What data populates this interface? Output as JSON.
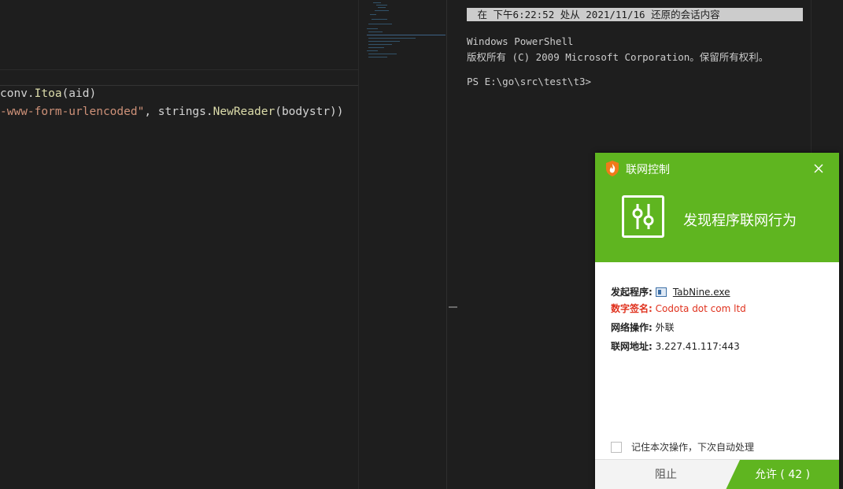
{
  "editor": {
    "lines": [
      {
        "parts": [
          {
            "t": "conv.",
            "c": "plain"
          },
          {
            "t": "Itoa",
            "c": "fn"
          },
          {
            "t": "(aid)",
            "c": "plain"
          }
        ]
      },
      {
        "parts": [
          {
            "t": "-www-form-urlencoded\"",
            "c": "str"
          },
          {
            "t": ", strings.",
            "c": "plain"
          },
          {
            "t": "NewReader",
            "c": "fn"
          },
          {
            "t": "(bodystr))",
            "c": "plain"
          }
        ]
      }
    ]
  },
  "terminal": {
    "restore_banner": " 在 下午6:22:52 处从 2021/11/16 还原的会话内容",
    "line1": "Windows PowerShell",
    "line2": "版权所有 (C) 2009 Microsoft Corporation。保留所有权利。",
    "prompt": "PS E:\\go\\src\\test\\t3>"
  },
  "dialog": {
    "title": "联网控制",
    "headline": "发现程序联网行为",
    "rows": {
      "program_label": "发起程序:",
      "program_value": "TabNine.exe",
      "signature_label": "数字签名:",
      "signature_value": "Codota dot com ltd",
      "operation_label": "网络操作:",
      "operation_value": "外联",
      "address_label": "联网地址:",
      "address_value": "3.227.41.117:443"
    },
    "remember_label": "记住本次操作，下次自动处理",
    "block_label": "阻止",
    "allow_label": "允许 ( 42 )",
    "accent_color": "#5fb520",
    "warn_color": "#e0321e",
    "icons": {
      "title": "shield-flame-icon",
      "close": "close-icon",
      "main": "sliders-icon",
      "program": "exe-window-icon"
    }
  }
}
